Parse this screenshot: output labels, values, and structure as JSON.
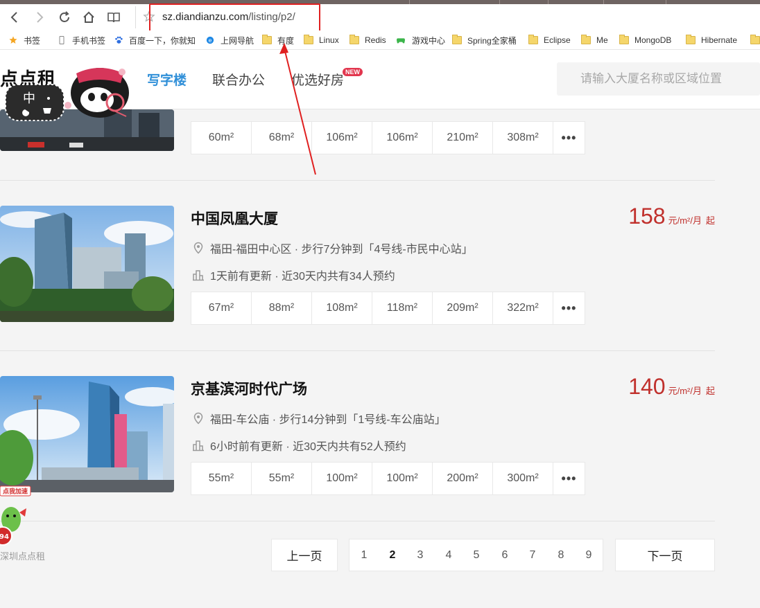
{
  "browser": {
    "url_host": "sz.diandianzu.com",
    "url_path": "/listing/p2/"
  },
  "bookmarks": [
    {
      "label": "书签",
      "icon": "star-icon"
    },
    {
      "label": "手机书签",
      "icon": "phone-icon"
    },
    {
      "label": "百度一下，你就知",
      "icon": "baidu-paw-icon"
    },
    {
      "label": "上网导航",
      "icon": "ie-icon"
    },
    {
      "label": "有度",
      "icon": "folder-icon"
    },
    {
      "label": "Linux",
      "icon": "folder-icon"
    },
    {
      "label": "Redis",
      "icon": "folder-icon"
    },
    {
      "label": "游戏中心",
      "icon": "gamepad-icon"
    },
    {
      "label": "Spring全家桶",
      "icon": "folder-icon"
    },
    {
      "label": "Eclipse",
      "icon": "folder-icon"
    },
    {
      "label": "Me",
      "icon": "folder-icon"
    },
    {
      "label": "MongoDB",
      "icon": "folder-icon"
    },
    {
      "label": "Hibernate",
      "icon": "folder-icon"
    }
  ],
  "site": {
    "logo": "点点租",
    "nav": [
      "写字楼",
      "联合办公",
      "优选好房"
    ],
    "new_badge": "NEW",
    "search_placeholder": "请输入大厦名称或区域位置",
    "mascot_badge": "中"
  },
  "listings": [
    {
      "title": "",
      "sizes": [
        "60m²",
        "68m²",
        "106m²",
        "106m²",
        "210m²",
        "308m²"
      ],
      "more": "•••"
    },
    {
      "title": "中国凤凰大厦",
      "price": "158",
      "unit": "元/m²/月",
      "qi": "起",
      "location": "福田-福田中心区 · 步行7分钟到「4号线-市民中心站」",
      "updated": "1天前有更新 · 近30天内共有34人预约",
      "sizes": [
        "67m²",
        "88m²",
        "108m²",
        "118m²",
        "209m²",
        "322m²"
      ],
      "more": "•••"
    },
    {
      "title": "京基滨河时代广场",
      "price": "140",
      "unit": "元/m²/月",
      "qi": "起",
      "location": "福田-车公庙 · 步行14分钟到「1号线-车公庙站」",
      "updated": "6小时前有更新 · 近30天内共有52人预约",
      "sizes": [
        "55m²",
        "55m²",
        "100m²",
        "100m²",
        "200m²",
        "300m²"
      ],
      "more": "•••"
    }
  ],
  "pagination": {
    "prev": "上一页",
    "next": "下一页",
    "pages": [
      "1",
      "2",
      "3",
      "4",
      "5",
      "6",
      "7",
      "8",
      "9"
    ],
    "current": "2"
  },
  "footer": {
    "city_label": "深圳点点租",
    "promo_text": "点我加速",
    "promo_number": "94"
  },
  "colors": {
    "accent": "#2f8fd8",
    "price": "#c0302c",
    "annotation": "#e02020"
  }
}
